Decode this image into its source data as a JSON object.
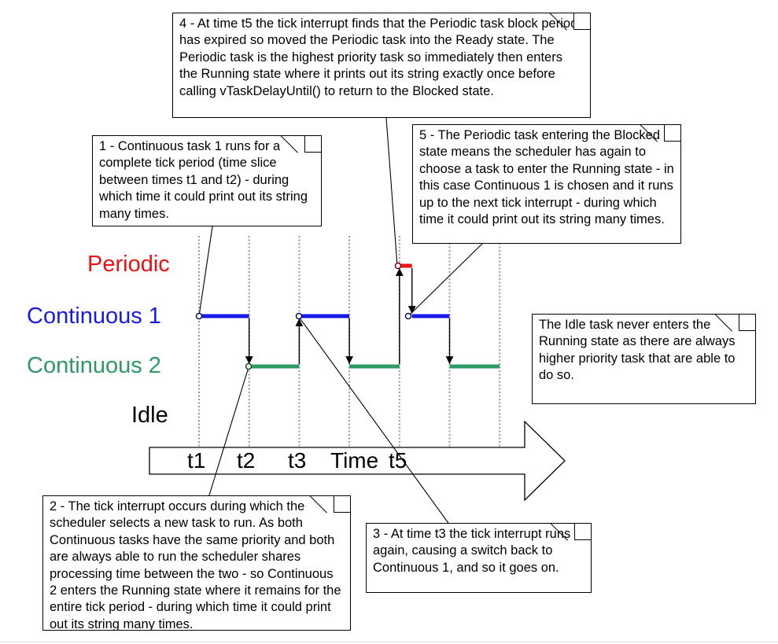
{
  "tasks": [
    {
      "key": "periodic",
      "label": "Periodic",
      "color": "#ee1111"
    },
    {
      "key": "continuous1",
      "label": "Continuous 1",
      "color": "#1a1ae6"
    },
    {
      "key": "continuous2",
      "label": "Continuous 2",
      "color": "#2e9a63"
    },
    {
      "key": "idle",
      "label": "Idle",
      "color": "#000000"
    }
  ],
  "axis": {
    "tick_labels": [
      "t1",
      "t2",
      "t3",
      "Time",
      "t5"
    ]
  },
  "notes": {
    "n1": "1 - Continuous task 1 runs for a complete tick period (time slice between times t1 and t2) - during which time it could print out its string many times.",
    "n2": "2 - The tick interrupt occurs during which the scheduler selects a new task to run.  As both Continuous tasks have the same priority and both are always able to run the scheduler shares processing time between the two - so Continuous 2 enters the Running state where it remains for the entire tick period - during which time it could print out its string many times.",
    "n3": "3 - At time t3 the tick interrupt runs again, causing a switch back to Continuous 1, and so it goes on.",
    "n4": "4 - At time t5 the tick interrupt finds that the Periodic task block period has expired so moved the Periodic task into the Ready state.  The Periodic task is the highest priority task so immediately then enters the Running state where it prints out its string exactly once before calling vTaskDelayUntil() to return to the Blocked state.",
    "n5": "5 - The Periodic task entering the Blocked state means the scheduler has again to choose a task to enter the Running state - in this case Continuous 1 is chosen and it runs up to the next tick interrupt - during which time it could print out its string many times.",
    "idle": "The Idle task never enters the Running state as there are always higher priority task that are able to do so."
  },
  "schedule": [
    {
      "task": "continuous1",
      "start": 1,
      "end": 2
    },
    {
      "task": "continuous2",
      "start": 2,
      "end": 3
    },
    {
      "task": "continuous1",
      "start": 3,
      "end": 4
    },
    {
      "task": "continuous2",
      "start": 4,
      "end": 5
    },
    {
      "task": "periodic",
      "start": 5,
      "end": 5.25
    },
    {
      "task": "continuous1",
      "start": 5.25,
      "end": 6
    },
    {
      "task": "continuous2",
      "start": 6,
      "end": 7
    }
  ],
  "switches": [
    {
      "from": "continuous1",
      "to": "continuous2",
      "at": 2
    },
    {
      "from": "continuous2",
      "to": "continuous1",
      "at": 3
    },
    {
      "from": "continuous1",
      "to": "continuous2",
      "at": 4
    },
    {
      "from": "continuous2",
      "to": "periodic",
      "at": 5
    },
    {
      "from": "periodic",
      "to": "continuous1",
      "at": 5.25
    },
    {
      "from": "continuous1",
      "to": "continuous2",
      "at": 6
    }
  ],
  "tick_count": 7
}
